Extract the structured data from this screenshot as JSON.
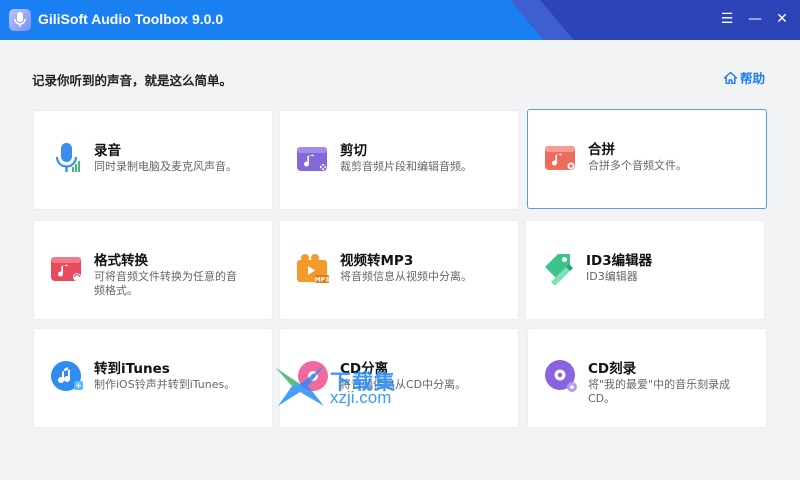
{
  "window": {
    "title": "GiliSoft Audio Toolbox 9.0.0",
    "controls": {
      "menu": "☰",
      "minimize": "—",
      "close": "✕"
    }
  },
  "header": {
    "subtitle": "记录你听到的声音，就是这么简单。",
    "help_label": "帮助",
    "help_icon": "home-icon"
  },
  "cards": [
    {
      "title": "录音",
      "desc": "同时录制电脑及麦克风声音。",
      "icon": "microphone-icon"
    },
    {
      "title": "剪切",
      "desc": "裁剪音频片段和编辑音频。",
      "icon": "audio-cut-icon"
    },
    {
      "title": "合拼",
      "desc": "合拼多个音频文件。",
      "icon": "audio-merge-icon",
      "selected": true
    },
    {
      "title": "格式转换",
      "desc": "可将音频文件转换为任意的音频格式。",
      "icon": "format-convert-icon"
    },
    {
      "title": "视频转MP3",
      "desc": "将音频信息从视频中分离。",
      "icon": "video-to-mp3-icon"
    },
    {
      "title": "ID3编辑器",
      "desc": "ID3编辑器",
      "icon": "tag-edit-icon"
    },
    {
      "title": "转到iTunes",
      "desc": "制作iOS铃声并转到iTunes。",
      "icon": "itunes-icon"
    },
    {
      "title": "CD分离",
      "desc": "将音频信息从CD中分离。",
      "icon": "cd-rip-icon"
    },
    {
      "title": "CD刻录",
      "desc": "将\"我的最爱\"中的音乐刻录成CD。",
      "icon": "cd-burn-icon"
    }
  ],
  "watermark": {
    "line1": "下载集",
    "line2": "xzji.com"
  },
  "colors": {
    "titlebar": "#1a7ff0",
    "accent": "#1a7ff0",
    "selected_border": "#5d9be6"
  }
}
